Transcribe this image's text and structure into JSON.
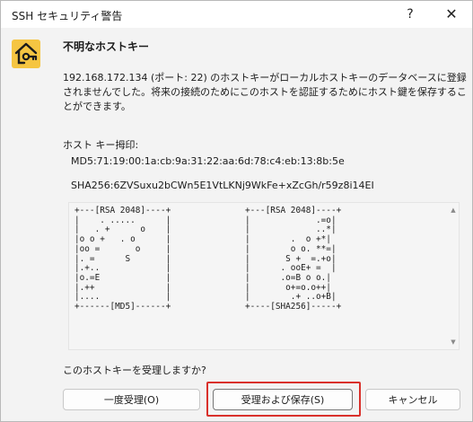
{
  "window": {
    "title": "SSH セキュリティ警告",
    "help_glyph": "?",
    "close_glyph": "✕"
  },
  "heading": "不明なホストキー",
  "message": "192.168.172.134 (ポート: 22) のホストキーがローカルホストキーのデータベースに登録されませんでした。将来の接続のためにこのホストを認証するためにホスト鍵を保存することができます。",
  "fingerprint": {
    "label": "ホスト キー拇印:",
    "md5": "MD5:71:19:00:1a:cb:9a:31:22:aa:6d:78:c4:eb:13:8b:5e",
    "sha256": "SHA256:6ZVSuxu2bCWn5E1VtLKNj9WkFe+xZcGh/r59z8i14EI"
  },
  "randomart": {
    "md5": "+---[RSA 2048]----+\n|    . .....      |\n|   . +      o    |\n|o o +   . o      |\n|oo =       o     |\n|. =      S       |\n|.+..             |\n|o.=E             |\n|.++              |\n|....             |\n+------[MD5]------+",
    "sha256": "+---[RSA 2048]----+\n|             .=o|\n|             ..*|\n|        .  o +*|\n|        o o. **=|\n|       S +  =.+o|\n|      . ooE+ =  |\n|      .o=B o o.|\n|       o+=o.o++|\n|        .+ ..o+B|\n+----[SHA256]-----+"
  },
  "scrollbar": {
    "up_glyph": "▲",
    "down_glyph": "▼"
  },
  "question": "このホストキーを受理しますか?",
  "buttons": {
    "accept_once": "一度受理(O)",
    "accept_save": "受理および保存(S)",
    "cancel": "キャンセル"
  },
  "colors": {
    "icon_bg": "#f5c542",
    "focus_ring": "#d9302b"
  },
  "icons": {
    "warning_icon": "house-key-icon"
  }
}
